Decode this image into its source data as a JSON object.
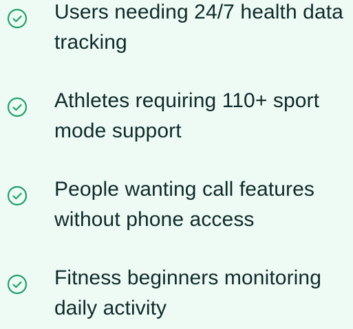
{
  "colors": {
    "background": "#eefbf4",
    "text": "#0f2a2a",
    "icon": "#22a06b"
  },
  "icon_name": "check-circle-icon",
  "items": [
    {
      "text": "Users needing 24/7 health data tracking"
    },
    {
      "text": "Athletes requiring 110+ sport mode support"
    },
    {
      "text": "People wanting call features without phone access"
    },
    {
      "text": "Fitness beginners monitoring daily activity"
    }
  ]
}
